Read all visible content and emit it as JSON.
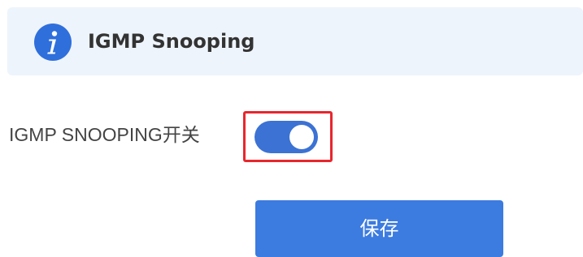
{
  "banner": {
    "icon": "info-icon",
    "title": "IGMP Snooping"
  },
  "form": {
    "toggle_label": "IGMP SNOOPING开关",
    "toggle_state": "on",
    "highlight_color": "#e8262d"
  },
  "actions": {
    "save_label": "保存"
  },
  "colors": {
    "accent": "#3b72d4",
    "banner_bg": "#eef4fc",
    "info_icon": "#2f6fdc"
  }
}
